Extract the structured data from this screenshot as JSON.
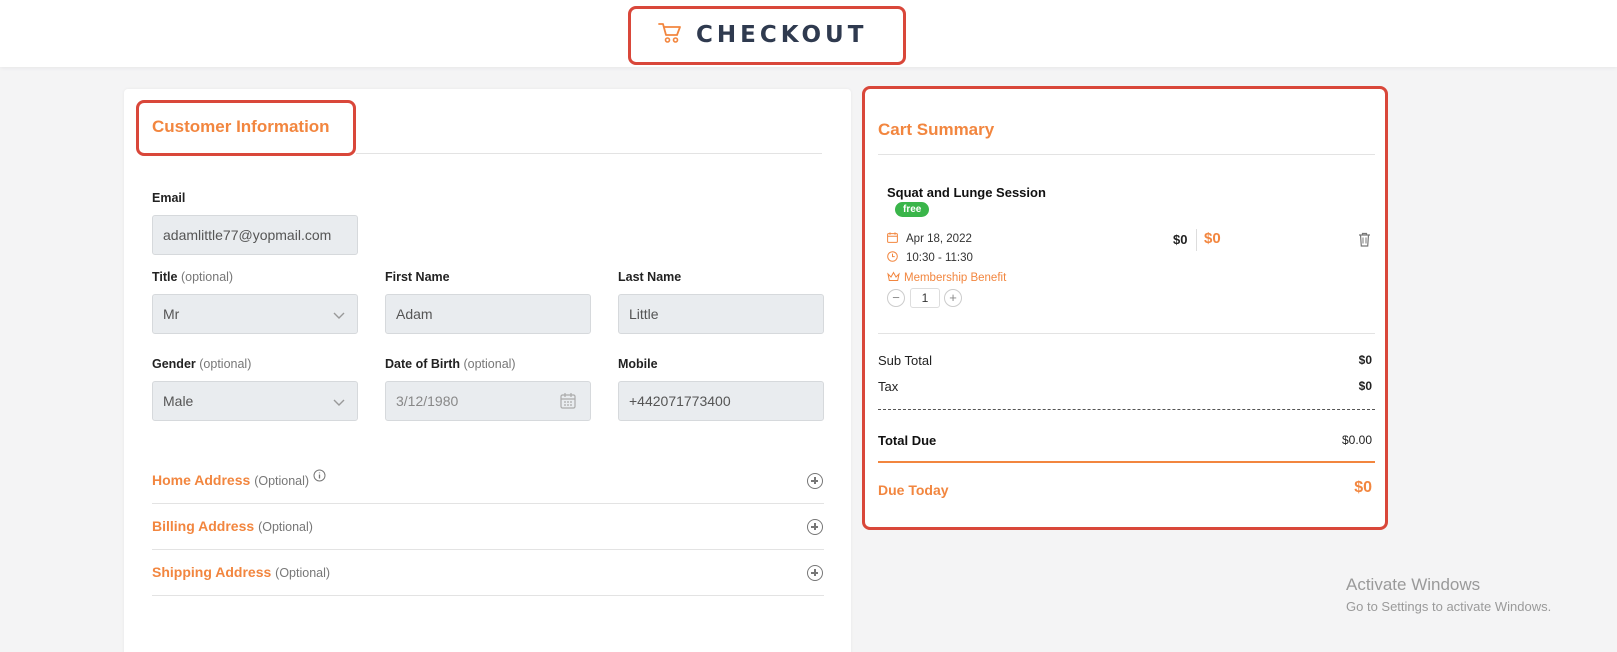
{
  "header": {
    "title": "CHECKOUT",
    "cart_icon": "cart-icon"
  },
  "customer": {
    "title": "Customer Information",
    "email": {
      "label": "Email",
      "value": "adamlittle77@yopmail.com"
    },
    "title_field": {
      "label": "Title",
      "optional": "(optional)",
      "value": "Mr"
    },
    "first_name": {
      "label": "First Name",
      "value": "Adam"
    },
    "last_name": {
      "label": "Last Name",
      "value": "Little"
    },
    "gender": {
      "label": "Gender",
      "optional": "(optional)",
      "value": "Male"
    },
    "dob": {
      "label": "Date of Birth",
      "optional": "(optional)",
      "value": "3/12/1980"
    },
    "mobile": {
      "label": "Mobile",
      "value": "+442071773400"
    },
    "home_address": {
      "label": "Home Address",
      "optional": "(Optional)"
    },
    "billing_address": {
      "label": "Billing Address",
      "optional": "(Optional)"
    },
    "shipping_address": {
      "label": "Shipping Address",
      "optional": "(Optional)"
    }
  },
  "cart": {
    "title": "Cart Summary",
    "item": {
      "name": "Squat and Lunge Session",
      "badge": "free",
      "date": "Apr 18, 2022",
      "time": "10:30 - 11:30",
      "benefit": "Membership Benefit",
      "quantity": "1",
      "price": "$0",
      "price_discounted": "$0"
    },
    "sub_total_label": "Sub Total",
    "sub_total": "$0",
    "tax_label": "Tax",
    "tax": "$0",
    "total_due_label": "Total Due",
    "total_due": "$0.00",
    "due_today_label": "Due Today",
    "due_today": "$0"
  },
  "watermark": {
    "title": "Activate Windows",
    "subtitle": "Go to Settings to activate Windows."
  },
  "colors": {
    "accent": "#f2863f",
    "highlight": "#d9473a",
    "badge": "#3ab54a"
  }
}
